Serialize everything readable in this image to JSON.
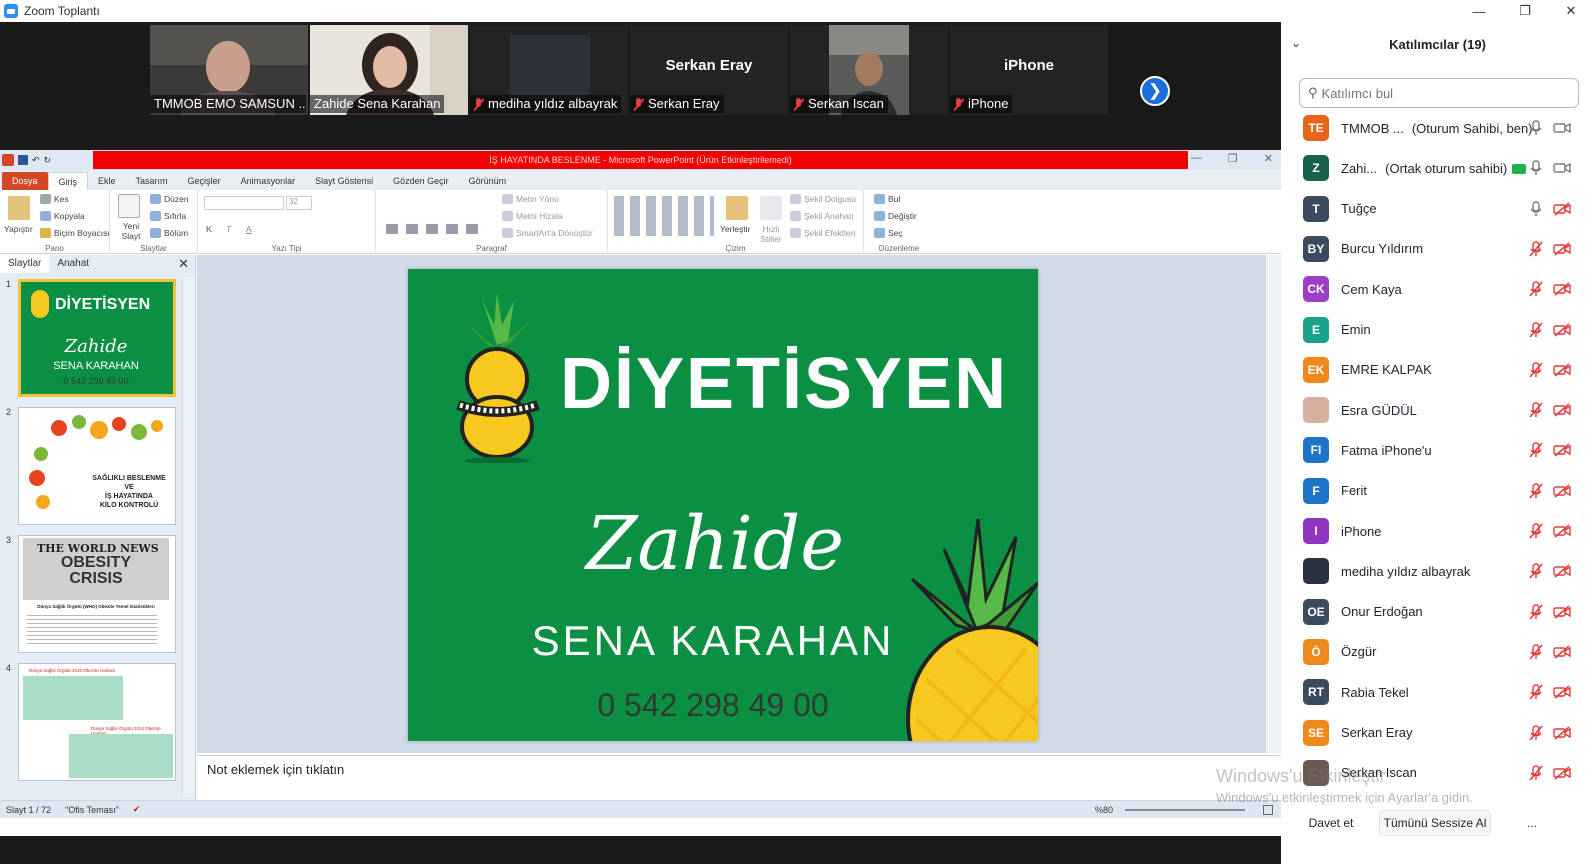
{
  "window": {
    "title": "Zoom Toplantı"
  },
  "videos": [
    {
      "name": "TMMOB EMO SAMSUN ...",
      "muted": false,
      "kind": "video-man"
    },
    {
      "name": "Zahide Sena Karahan",
      "muted": false,
      "kind": "video-woman",
      "active": true
    },
    {
      "name": "mediha yıldız albayrak",
      "muted": true,
      "kind": "video-dark"
    },
    {
      "name": "Serkan Eray",
      "muted": true,
      "kind": "name-only",
      "big": "Serkan Eray"
    },
    {
      "name": "Serkan Iscan",
      "muted": true,
      "kind": "video-car"
    },
    {
      "name": "iPhone",
      "muted": true,
      "kind": "name-only",
      "big": "iPhone"
    }
  ],
  "ppt": {
    "title": "İŞ HAYATINDA BESLENME - Microsoft PowerPoint (Ürün Etkinleştirilemedi)",
    "tabs": [
      "Dosya",
      "Giriş",
      "Ekle",
      "Tasarım",
      "Geçişler",
      "Animasyonlar",
      "Slayt Gösterisi",
      "Gözden Geçir",
      "Görünüm"
    ],
    "ribbon": {
      "pano": {
        "label": "Pano",
        "paste": "Yapıştır",
        "cut": "Kes",
        "copy": "Kopyala",
        "painter": "Biçim Boyacısı"
      },
      "slaytlar": {
        "label": "Slaytlar",
        "new": "Yeni Slayt",
        "layout": "Düzen",
        "reset": "Sıfırla",
        "section": "Bölüm"
      },
      "yazitipi": {
        "label": "Yazı Tipi",
        "size": "32"
      },
      "paragraf": {
        "label": "Paragraf",
        "dir": "Metin Yönü",
        "align": "Metni Hizala",
        "smart": "SmartArt'a Dönüştür"
      },
      "cizim": {
        "label": "Çizim",
        "arrange": "Yerleştir",
        "styles": "Hızlı Stiller",
        "fill": "Şekil Dolgusu",
        "outline": "Şekil Anahatı",
        "effects": "Şekil Efektleri"
      },
      "duzenleme": {
        "label": "Düzenleme",
        "find": "Bul",
        "replace": "Değiştir",
        "select": "Seç"
      }
    },
    "panel_tabs": [
      "Slaytlar",
      "Anahat"
    ],
    "thumbs": [
      {
        "num": "1",
        "title": "DİYETİSYEN",
        "name": "Zahide",
        "sub": "SENA KARAHAN",
        "phone": "0 542 298 49 00"
      },
      {
        "num": "2",
        "text1": "SAĞLIKLI BESLENME",
        "text2": "VE",
        "text3": "İŞ HAYATINDA",
        "text4": "KİLO KONTROLÜ"
      },
      {
        "num": "3",
        "headline": "THE WORLD NEWS",
        "big1": "OBESITY",
        "big2": "CRISIS",
        "caption": "Dünya Sağlık Örgütü (WHO) Obezite Temel İstatistikleri"
      },
      {
        "num": "4",
        "cap1": "Dünya Sağlık Örgütü 2010 Obezite Haritası",
        "cap2": "Dünya Sağlık Örgütü 2014 Obezite Haritası"
      }
    ],
    "slide": {
      "title": "DİYETİSYEN",
      "name": "Zahide",
      "sub": "SENA KARAHAN",
      "phone": "0 542 298 49 00"
    },
    "notes": "Not eklemek için tıklatın",
    "status": {
      "slide": "Slayt 1 / 72",
      "theme": "\"Ofis Teması\"",
      "zoom": "%80"
    }
  },
  "participants": {
    "title": "Katılımcılar (19)",
    "search_placeholder": "Katılımcı bul",
    "list": [
      {
        "initials": "TE",
        "name": "TMMOB ...",
        "role": "(Oturum Sahibi, ben)",
        "color": "#e8641b",
        "mic": "on",
        "video": "on"
      },
      {
        "initials": "Z",
        "name": "Zahi...",
        "role": "(Ortak oturum sahibi)",
        "color": "#17614d",
        "mic": "on",
        "video": "on",
        "share": true
      },
      {
        "initials": "T",
        "name": "Tuğçe",
        "color": "#3c4a5e",
        "mic": "on",
        "video": "off"
      },
      {
        "initials": "BY",
        "name": "Burcu Yıldırım",
        "color": "#3c4a5e",
        "mic": "off",
        "video": "off"
      },
      {
        "initials": "CK",
        "name": "Cem Kaya",
        "color": "#9b3fc4",
        "mic": "off",
        "video": "off"
      },
      {
        "initials": "E",
        "name": "Emin",
        "color": "#1aa38a",
        "mic": "off",
        "video": "off"
      },
      {
        "initials": "EK",
        "name": "EMRE KALPAK",
        "color": "#f0891b",
        "mic": "off",
        "video": "off"
      },
      {
        "initials": "",
        "name": "Esra GÜDÜL",
        "color": "#d8b0a0",
        "mic": "off",
        "video": "off",
        "photo": true
      },
      {
        "initials": "FI",
        "name": "Fatma iPhone'u",
        "color": "#1f73c9",
        "mic": "off",
        "video": "off"
      },
      {
        "initials": "F",
        "name": "Ferit",
        "color": "#1f73c9",
        "mic": "off",
        "video": "off"
      },
      {
        "initials": "I",
        "name": "iPhone",
        "color": "#8e35c2",
        "mic": "off",
        "video": "off"
      },
      {
        "initials": "",
        "name": "mediha yıldız albayrak",
        "color": "#2a3140",
        "mic": "off",
        "video": "off"
      },
      {
        "initials": "OE",
        "name": "Onur Erdoğan",
        "color": "#3c4a5e",
        "mic": "off",
        "video": "off"
      },
      {
        "initials": "Ö",
        "name": "Özgür",
        "color": "#f0891b",
        "mic": "off",
        "video": "off"
      },
      {
        "initials": "RT",
        "name": "Rabia Tekel",
        "color": "#3c4a5e",
        "mic": "off",
        "video": "off"
      },
      {
        "initials": "SE",
        "name": "Serkan Eray",
        "color": "#f0891b",
        "mic": "off",
        "video": "off"
      },
      {
        "initials": "",
        "name": "Serkan Iscan",
        "color": "#6b5a50",
        "mic": "off",
        "video": "off",
        "photo": true
      }
    ],
    "invite": "Davet et",
    "mute_all": "Tümünü Sessize Al",
    "more": "..."
  },
  "watermark": {
    "line1": "Windows'u Etkinleştir",
    "line2": "Windows'u etkinleştirmek için Ayarlar'a gidin."
  },
  "colors": {
    "slide_green": "#0b8f43",
    "zoom_blue": "#2d8cff",
    "mute_red": "#e43b3b",
    "ppt_red": "#f20000"
  }
}
